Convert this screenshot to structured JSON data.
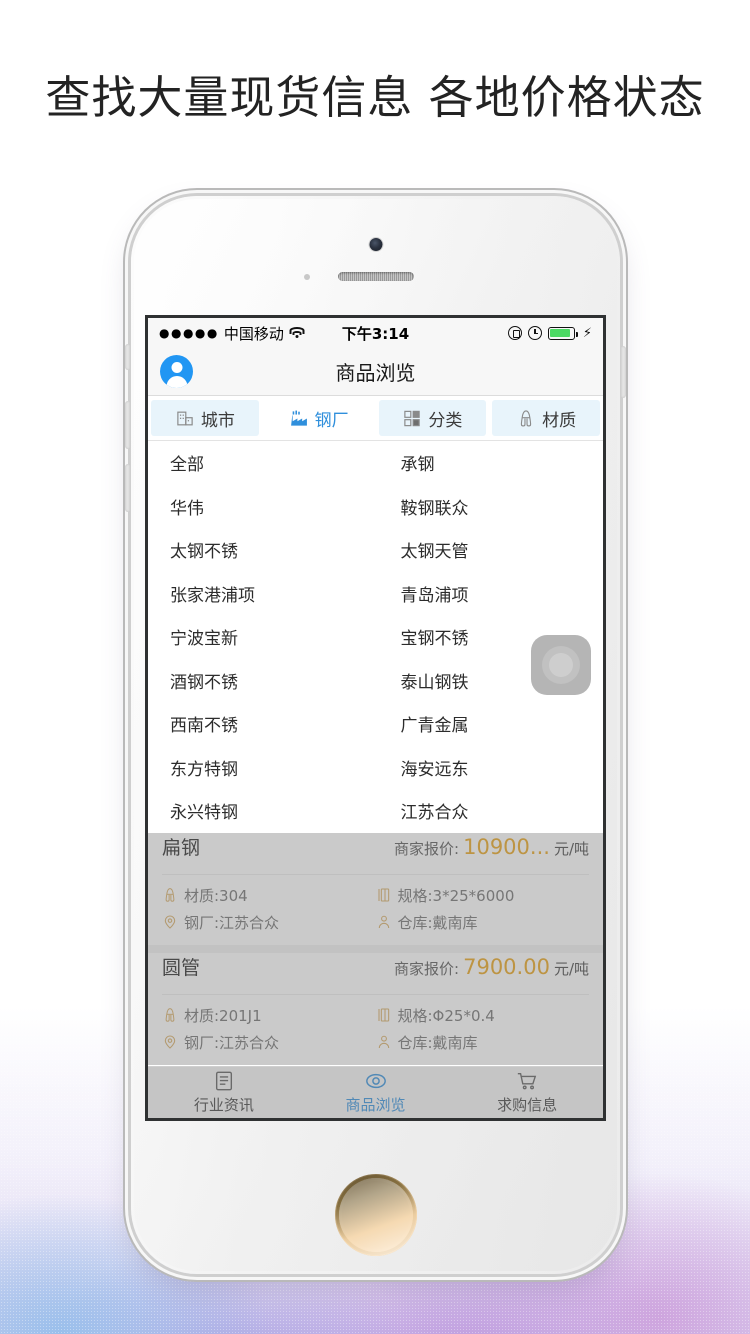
{
  "headline": "查找大量现货信息 各地价格状态",
  "status_bar": {
    "signal_dots": "●●●●●",
    "carrier": "中国移动",
    "wifi_icon": "wifi-icon",
    "time": "下午3:14",
    "lock_icon": "rotation-lock-icon",
    "alarm_icon": "alarm-clock-icon",
    "battery_icon": "battery-icon",
    "charging_icon": "charging-bolt-icon",
    "battery_color": "#4cd964"
  },
  "navbar": {
    "avatar_icon": "user-avatar-icon",
    "title": "商品浏览"
  },
  "filters": [
    {
      "label": "城市",
      "icon": "building-icon",
      "active": false
    },
    {
      "label": "钢厂",
      "icon": "factory-icon",
      "active": true
    },
    {
      "label": "分类",
      "icon": "grid-category-icon",
      "active": false
    },
    {
      "label": "材质",
      "icon": "material-icon",
      "active": false
    }
  ],
  "dropdown": {
    "rows": [
      [
        "全部",
        "承钢"
      ],
      [
        "华伟",
        "鞍钢联众"
      ],
      [
        "太钢不锈",
        "太钢天管"
      ],
      [
        "张家港浦项",
        "青岛浦项"
      ],
      [
        "宁波宝新",
        "宝钢不锈"
      ],
      [
        "酒钢不锈",
        "泰山钢铁"
      ],
      [
        "西南不锈",
        "广青金属"
      ],
      [
        "东方特钢",
        "海安远东"
      ],
      [
        "永兴特钢",
        "江苏合众"
      ]
    ]
  },
  "products": {
    "price_label": "商家报价:",
    "accent_color": "#e8a317",
    "items": [
      {
        "title": "扁钢",
        "price": "10900...",
        "unit": "元/吨",
        "material_label": "材质:304",
        "material_icon": "material-icon",
        "spec_label": "规格:3*25*6000",
        "spec_icon": "spec-icon",
        "mill_label": "钢厂:江苏合众",
        "mill_icon": "location-pin-icon",
        "warehouse_label": "仓库:戴南库",
        "warehouse_icon": "person-icon"
      },
      {
        "title": "圆管",
        "price": "7900.00",
        "unit": "元/吨",
        "material_label": "材质:201J1",
        "material_icon": "material-icon",
        "spec_label": "规格:Φ25*0.4",
        "spec_icon": "spec-icon",
        "mill_label": "钢厂:江苏合众",
        "mill_icon": "location-pin-icon",
        "warehouse_label": "仓库:戴南库",
        "warehouse_icon": "person-icon"
      }
    ]
  },
  "assistive_button": {
    "icon": "assistive-touch-icon"
  },
  "tabbar": {
    "active_color": "#2f8fdc",
    "items": [
      {
        "label": "行业资讯",
        "icon": "news-list-icon",
        "active": false
      },
      {
        "label": "商品浏览",
        "icon": "eye-browse-icon",
        "active": true
      },
      {
        "label": "求购信息",
        "icon": "shopping-cart-icon",
        "active": false
      }
    ]
  }
}
